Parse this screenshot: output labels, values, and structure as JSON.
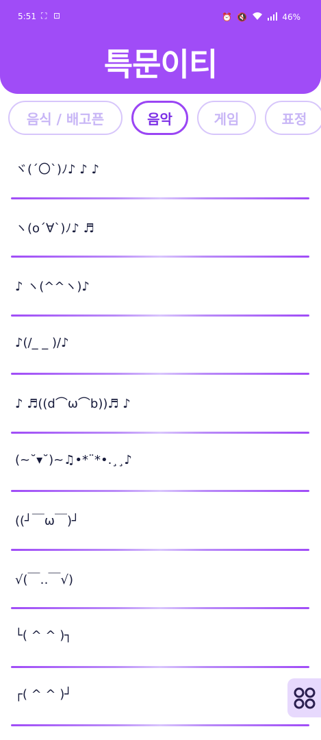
{
  "status_bar": {
    "time": "5:51",
    "battery": "46%",
    "icons": [
      "screen-record-icon",
      "screenshot-icon",
      "alarm-icon",
      "mute-icon",
      "wifi-icon",
      "signal-icon"
    ]
  },
  "header": {
    "title": "특문이티",
    "color": "#a04cf7"
  },
  "tabs": [
    {
      "label": "음식 / 배고픈",
      "active": false
    },
    {
      "label": "음악",
      "active": true
    },
    {
      "label": "게임",
      "active": false
    },
    {
      "label": "표정",
      "active": false
    }
  ],
  "items": [
    {
      "text": "ヾ(´〇`)ﾉ♪ ♪ ♪"
    },
    {
      "text": "ヽ(o´∀`)ﾉ♪ ♬"
    },
    {
      "text": "♪ ヽ(^^ヽ)♪"
    },
    {
      "text": "♪(/_ _ )/♪"
    },
    {
      "text": "♪ ♬((d⌒ω⌒b))♬ ♪"
    },
    {
      "text": "(~˘▾˘)~♫•*¨*•.¸¸♪"
    },
    {
      "text": "((┘￣ω￣)┘"
    },
    {
      "text": "√(￣‥￣√)"
    },
    {
      "text": "└( ^ ^ )┐"
    },
    {
      "text": "┌( ^ ^ )┘"
    }
  ],
  "fab": {
    "icon": "grid-menu-icon"
  }
}
